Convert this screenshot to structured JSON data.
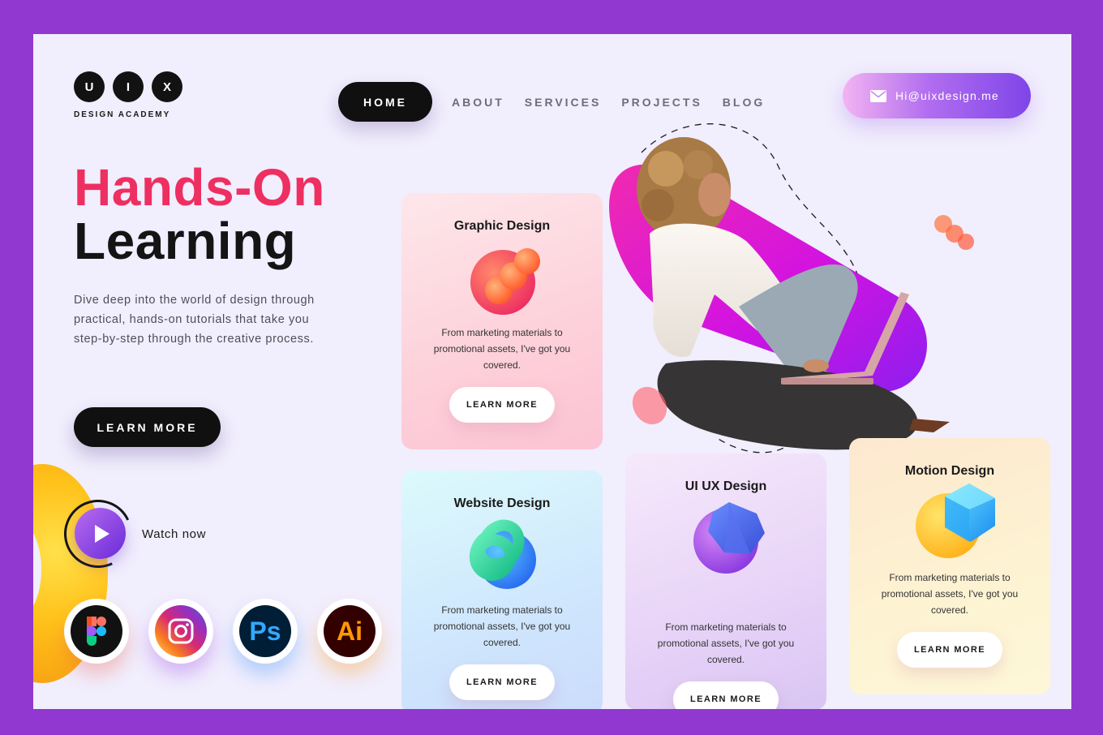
{
  "logo": {
    "letters": [
      "U",
      "I",
      "X"
    ],
    "subtitle": "DESIGN ACADEMY"
  },
  "nav": {
    "items": [
      "HOME",
      "ABOUT",
      "SERVICES",
      "PROJECTS",
      "BLOG"
    ],
    "active": "HOME"
  },
  "contact": {
    "email": "Hi@uixdesign.me",
    "icon": "mail-icon"
  },
  "hero": {
    "title_line1": "Hands-On",
    "title_line2": "Learning",
    "description": "Dive deep into the world of design through practical, hands-on tutorials that take you step-by-step through the creative process.",
    "cta_label": "LEARN MORE",
    "watch_label": "Watch now"
  },
  "tools": [
    {
      "name": "figma-icon"
    },
    {
      "name": "instagram-icon"
    },
    {
      "name": "photoshop-icon",
      "label": "Ps"
    },
    {
      "name": "illustrator-icon",
      "label": "Ai"
    }
  ],
  "cards": [
    {
      "title": "Graphic Design",
      "description": "From marketing materials to promotional assets, I've got you covered.",
      "button": "LEARN MORE"
    },
    {
      "title": "Website Design",
      "description": "From marketing materials to promotional assets, I've got you covered.",
      "button": "LEARN MORE"
    },
    {
      "title": "UI UX Design",
      "description": "From marketing materials to promotional assets, I've got you covered.",
      "button": "LEARN MORE"
    },
    {
      "title": "Motion Design",
      "description": "From marketing materials to promotional assets, I've got you covered.",
      "button": "LEARN MORE"
    }
  ],
  "colors": {
    "frame": "#9038cf",
    "background": "#f1eefd",
    "accent_red": "#ee2f61",
    "dark": "#101010"
  }
}
